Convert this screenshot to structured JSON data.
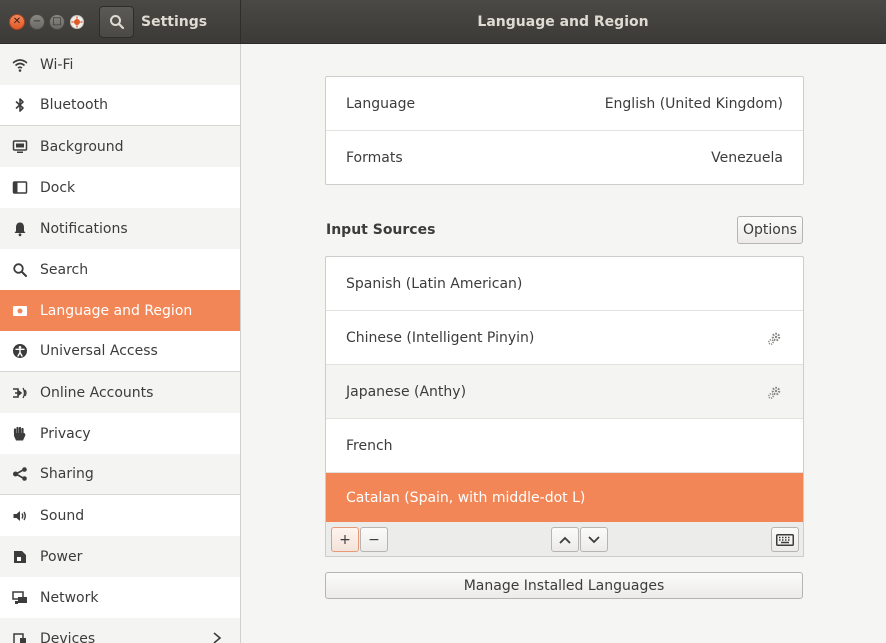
{
  "window": {
    "app_title": "Settings",
    "title": "Language and Region",
    "accent": "#f38656"
  },
  "sidebar": {
    "items": [
      {
        "label": "Wi-Fi",
        "icon": "wifi-icon"
      },
      {
        "label": "Bluetooth",
        "icon": "bluetooth-icon"
      },
      {
        "label": "Background",
        "icon": "background-icon"
      },
      {
        "label": "Dock",
        "icon": "dock-icon"
      },
      {
        "label": "Notifications",
        "icon": "bell-icon"
      },
      {
        "label": "Search",
        "icon": "search-icon"
      },
      {
        "label": "Language and Region",
        "icon": "flag-icon",
        "selected": true
      },
      {
        "label": "Universal Access",
        "icon": "accessibility-icon"
      },
      {
        "label": "Online Accounts",
        "icon": "online-accounts-icon"
      },
      {
        "label": "Privacy",
        "icon": "hand-icon"
      },
      {
        "label": "Sharing",
        "icon": "share-icon"
      },
      {
        "label": "Sound",
        "icon": "speaker-icon"
      },
      {
        "label": "Power",
        "icon": "power-icon"
      },
      {
        "label": "Network",
        "icon": "network-icon"
      },
      {
        "label": "Devices",
        "icon": "devices-icon"
      }
    ]
  },
  "language": {
    "language_label": "Language",
    "language_value": "English (United Kingdom)",
    "formats_label": "Formats",
    "formats_value": "Venezuela"
  },
  "input_sources": {
    "title": "Input Sources",
    "options_label": "Options",
    "items": [
      {
        "label": "Spanish (Latin American)",
        "has_settings": false
      },
      {
        "label": "Chinese (Intelligent Pinyin)",
        "has_settings": true
      },
      {
        "label": "Japanese (Anthy)",
        "has_settings": true
      },
      {
        "label": "French",
        "has_settings": false
      },
      {
        "label": "Catalan (Spain, with middle-dot L)",
        "has_settings": false,
        "selected": true
      }
    ],
    "add_label": "+",
    "remove_label": "−"
  },
  "manage_label": "Manage Installed Languages"
}
